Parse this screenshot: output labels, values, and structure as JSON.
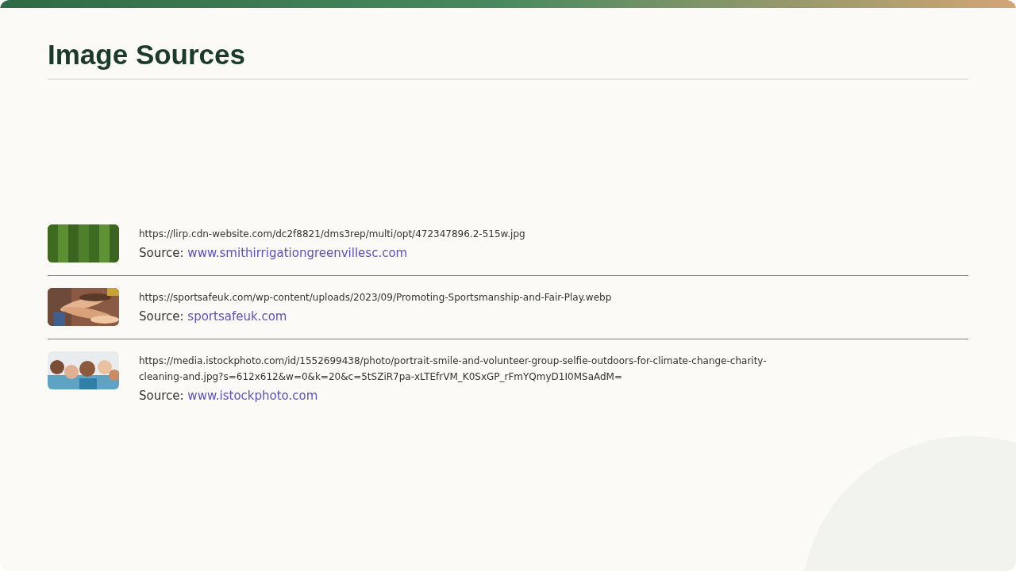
{
  "title": "Image Sources",
  "sources": [
    {
      "thumbnail": {
        "kind": "grass"
      },
      "url": "https://lirp.cdn-website.com/dc2f8821/dms3rep/multi/opt/472347896.2-515w.jpg",
      "label": "Source:",
      "link": "www.smithirrigationgreenvillesc.com"
    },
    {
      "thumbnail": {
        "kind": "hands"
      },
      "url": "https://sportsafeuk.com/wp-content/uploads/2023/09/Promoting-Sportsmanship-and-Fair-Play.webp",
      "label": "Source:",
      "link": "sportsafeuk.com"
    },
    {
      "thumbnail": {
        "kind": "group"
      },
      "url": "https://media.istockphoto.com/id/1552699438/photo/portrait-smile-and-volunteer-group-selfie-outdoors-for-climate-change-charity-cleaning-and.jpg?s=612x612&w=0&k=20&c=5tSZiR7pa-xLTEfrVM_K0SxGP_rFmYQmyD1I0MSaAdM=",
      "label": "Source:",
      "link": "www.istockphoto.com"
    }
  ]
}
